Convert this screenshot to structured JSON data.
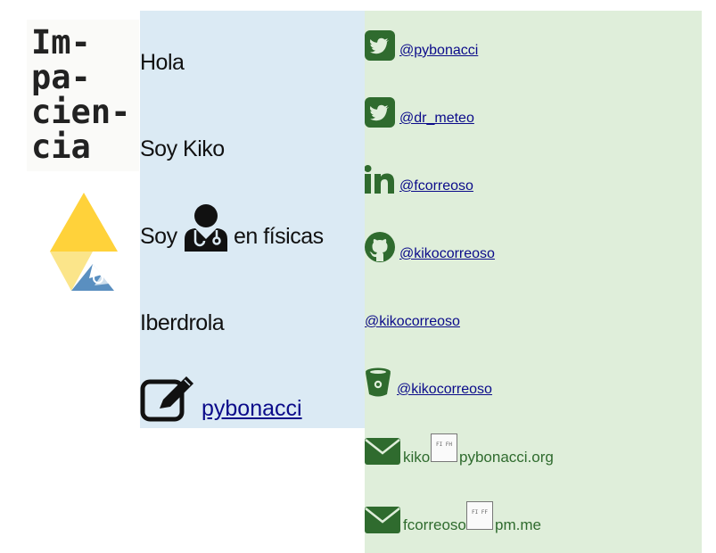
{
  "brand": {
    "title_lines": [
      "Im-",
      "pa-",
      "cien-",
      "cia"
    ]
  },
  "intro": {
    "line1": "Hola",
    "line2": "Soy Kiko",
    "line3_prefix": "Soy",
    "line3_suffix": "en físicas",
    "line4": "Iberdrola",
    "blog_link": "pybonacci"
  },
  "contacts": [
    {
      "icon": "twitter-icon",
      "text": "@pybonacci"
    },
    {
      "icon": "twitter-icon",
      "text": "@dr_meteo"
    },
    {
      "icon": "linkedin-icon",
      "text": "@fcorreoso"
    },
    {
      "icon": "github-icon",
      "text": "@kikocorreoso"
    },
    {
      "icon": "none",
      "text": "@kikocorreoso"
    },
    {
      "icon": "bitbucket-icon",
      "text": "@kikocorreoso"
    }
  ],
  "emails": [
    {
      "user": "kiko",
      "domain": "pybonacci.org",
      "at_glyph": "FI FH"
    },
    {
      "user": "fcorreoso",
      "domain": "pm.me",
      "at_glyph": "FI FF"
    }
  ],
  "colors": {
    "middle_panel_bg": "#dbeaf4",
    "right_panel_bg": "#dfeeda",
    "icon_green": "#2f6b2e",
    "link_blue": "#0b0b8a"
  }
}
